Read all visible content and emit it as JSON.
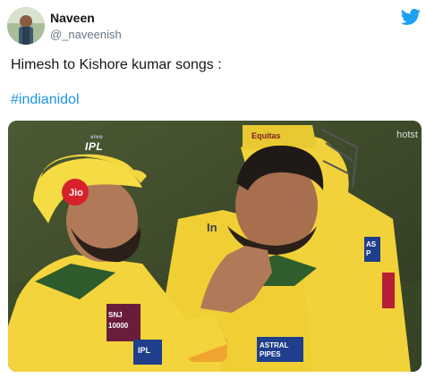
{
  "author": {
    "name": "Naveen",
    "handle": "@_naveenish"
  },
  "tweet": {
    "text": "Himesh to Kishore kumar songs :",
    "hashtag": "#indianidol"
  },
  "media": {
    "overlay_logo": "IPL",
    "overlay_logo_sub": "vivo",
    "watermark": "hotst",
    "jersey_texts": {
      "jio": "Jio",
      "sponsor_back": "Equitas",
      "snj": "SNJ 10000",
      "astral": "ASTRAL PIPES",
      "ipl_sleeve": "IPL",
      "side_text": "In",
      "as_text": "AS P"
    }
  },
  "icons": {
    "bird": "twitter-bird-icon",
    "avatar": "user-avatar"
  },
  "colors": {
    "twitter_blue": "#1da1f2",
    "hashtag_blue": "#1b95e0",
    "csk_yellow": "#f3d33b",
    "text_dark": "#14171a",
    "text_muted": "#657786"
  }
}
